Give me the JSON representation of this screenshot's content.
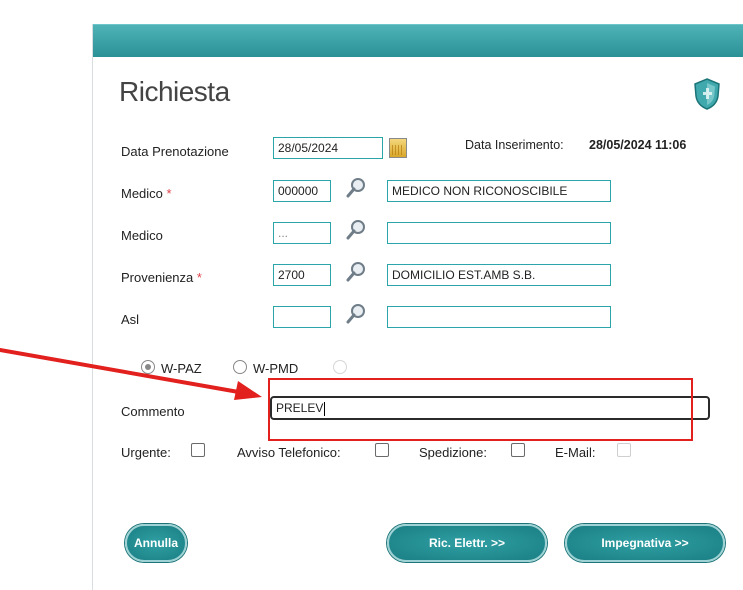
{
  "title": "Richiesta",
  "data_inserimento": {
    "label": "Data Inserimento:",
    "value": "28/05/2024 11:06"
  },
  "data_prenotazione": {
    "label": "Data Prenotazione",
    "value": "28/05/2024"
  },
  "medico1": {
    "label": "Medico",
    "required": "*",
    "code": "000000",
    "description": "MEDICO NON RICONOSCIBILE"
  },
  "medico2": {
    "label": "Medico",
    "code": "...",
    "description": ""
  },
  "provenienza": {
    "label": "Provenienza",
    "required": "*",
    "code": "2700",
    "description": "DOMICILIO EST.AMB S.B."
  },
  "asl": {
    "label": "Asl",
    "code": "",
    "description": ""
  },
  "radios": [
    {
      "label": "W-PAZ",
      "checked": true
    },
    {
      "label": "W-PMD",
      "checked": false
    }
  ],
  "commento": {
    "label": "Commento",
    "value": "PRELEV"
  },
  "checks": {
    "urgente": "Urgente:",
    "avviso": "Avviso Telefonico:",
    "spedizione": "Spedizione:",
    "email": "E-Mail:"
  },
  "buttons": {
    "annulla": "Annulla",
    "ric_elettr": "Ric. Elettr. >>",
    "impegnativa": "Impegnativa >>"
  },
  "colors": {
    "accent": "#2a9196",
    "annotation": "#e2201e"
  },
  "icons": {
    "search": "magnifier-icon",
    "calendar": "calendar-icon",
    "shield": "shield-icon"
  }
}
